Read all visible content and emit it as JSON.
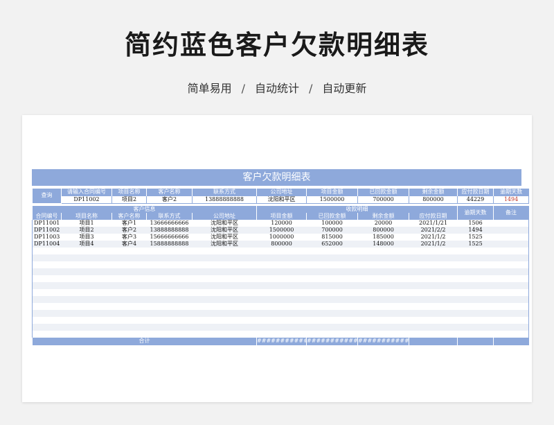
{
  "page": {
    "title": "简约蓝色客户欠款明细表",
    "subtitle_items": [
      "简单易用",
      "自动统计",
      "自动更新"
    ],
    "separator": "/"
  },
  "sheet": {
    "title": "客户欠款明细表",
    "accent_color": "#8ea9db",
    "query": {
      "label": "查询",
      "headers": [
        "请输入合同编号",
        "项目名称",
        "客户名称",
        "联系方式",
        "公司地址",
        "项目金额",
        "已回款金额",
        "剩余金额",
        "应付款日期",
        "逾期天数"
      ],
      "values": [
        "DP11002",
        "项目2",
        "客户2",
        "13888888888",
        "沈阳和平区",
        "1500000",
        "700000",
        "800000",
        "44229",
        "1494"
      ]
    },
    "group_headers": {
      "customer_info": "客户信息",
      "payment_detail": "收款明细",
      "overdue_days": "逾期天数",
      "remarks": "备注"
    },
    "columns": [
      "合同编号",
      "项目名称",
      "客户名称",
      "联系方式",
      "公司地址",
      "项目金额",
      "已回款金额",
      "剩余金额",
      "应付款日期"
    ],
    "rows": [
      [
        "DP11001",
        "项目1",
        "客户1",
        "13666666666",
        "沈阳和平区",
        "120000",
        "100000",
        "20000",
        "2021/1/21",
        "1506",
        ""
      ],
      [
        "DP11002",
        "项目2",
        "客户2",
        "13888888888",
        "沈阳和平区",
        "1500000",
        "700000",
        "800000",
        "2021/2/2",
        "1494",
        ""
      ],
      [
        "DP11003",
        "项目3",
        "客户3",
        "15666666666",
        "沈阳和平区",
        "1000000",
        "815000",
        "185000",
        "2021/1/2",
        "1525",
        ""
      ],
      [
        "DP11004",
        "项目4",
        "客户4",
        "15888888888",
        "沈阳和平区",
        "800000",
        "652000",
        "148000",
        "2021/1/2",
        "1525",
        ""
      ]
    ],
    "empty_rows": 13,
    "total": {
      "label": "合计",
      "project_amount": "#################",
      "received_amount": "#################",
      "remaining_amount": "#################"
    }
  }
}
